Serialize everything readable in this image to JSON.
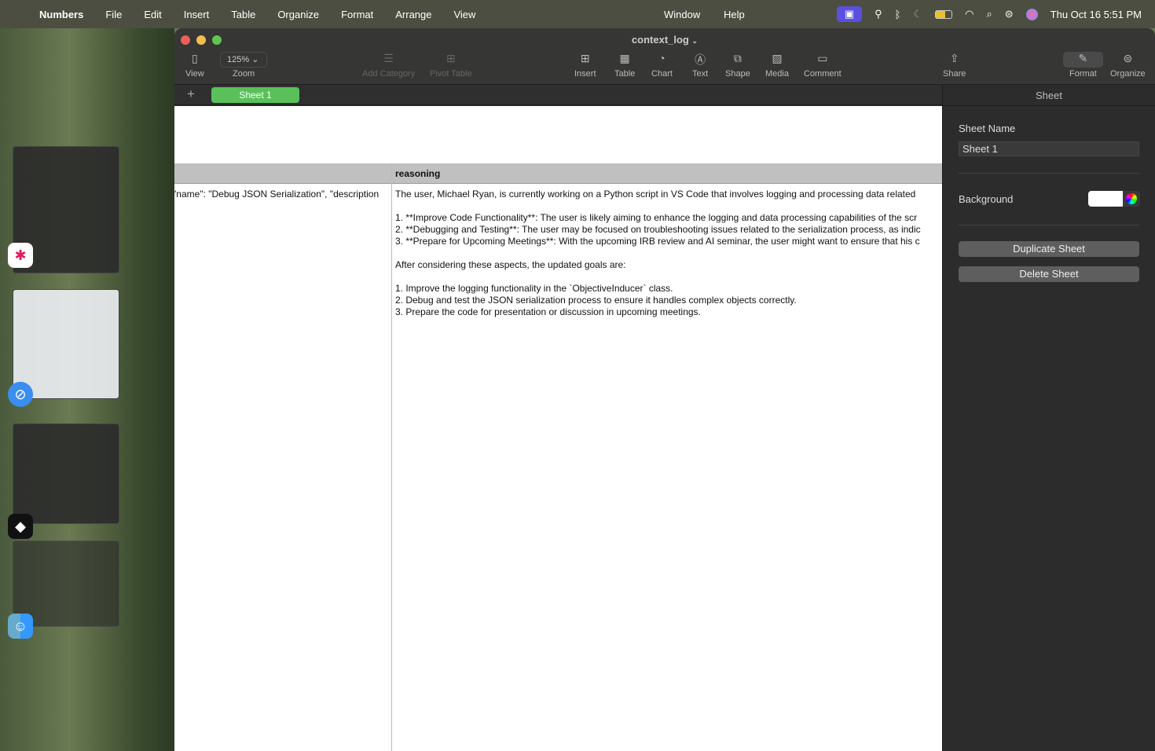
{
  "menubar": {
    "app": "Numbers",
    "items": [
      "File",
      "Edit",
      "Insert",
      "Table",
      "Organize",
      "Format",
      "Arrange",
      "View"
    ],
    "right_items": [
      "Window",
      "Help"
    ],
    "clock": "Thu Oct 16  5:51 PM"
  },
  "window": {
    "title": "context_log",
    "zoom": "125%",
    "toolbar": {
      "view": "View",
      "zoom": "Zoom",
      "add_category": "Add Category",
      "pivot_table": "Pivot Table",
      "insert": "Insert",
      "table": "Table",
      "chart": "Chart",
      "text": "Text",
      "shape": "Shape",
      "media": "Media",
      "comment": "Comment",
      "share": "Share",
      "format": "Format",
      "organize": "Organize"
    },
    "sheet_tab": "Sheet 1"
  },
  "table": {
    "header": [
      "",
      "reasoning"
    ],
    "cell_a": "'name\": \"Debug JSON Serialization\", \"description",
    "reasoning_lines": [
      "The user, Michael Ryan, is currently working on a Python script in VS Code that involves logging and processing data related",
      "",
      "1. **Improve Code Functionality**: The user is likely aiming to enhance the logging and data processing capabilities of the scr",
      "2. **Debugging and Testing**: The user may be focused on troubleshooting issues related to the serialization process, as indic",
      "3. **Prepare for Upcoming Meetings**: With the upcoming IRB review and AI seminar, the user might want to ensure that his c",
      "",
      "After considering these aspects, the updated goals are:",
      "",
      "1. Improve the logging functionality in the `ObjectiveInducer` class.",
      "2. Debug and test the JSON serialization process to ensure it handles complex objects correctly.",
      "3. Prepare the code for presentation or discussion in upcoming meetings."
    ]
  },
  "panel": {
    "title": "Sheet",
    "sheet_name_label": "Sheet Name",
    "sheet_name_value": "Sheet 1",
    "background_label": "Background",
    "background_color": "#ffffff",
    "duplicate": "Duplicate Sheet",
    "delete": "Delete Sheet"
  }
}
